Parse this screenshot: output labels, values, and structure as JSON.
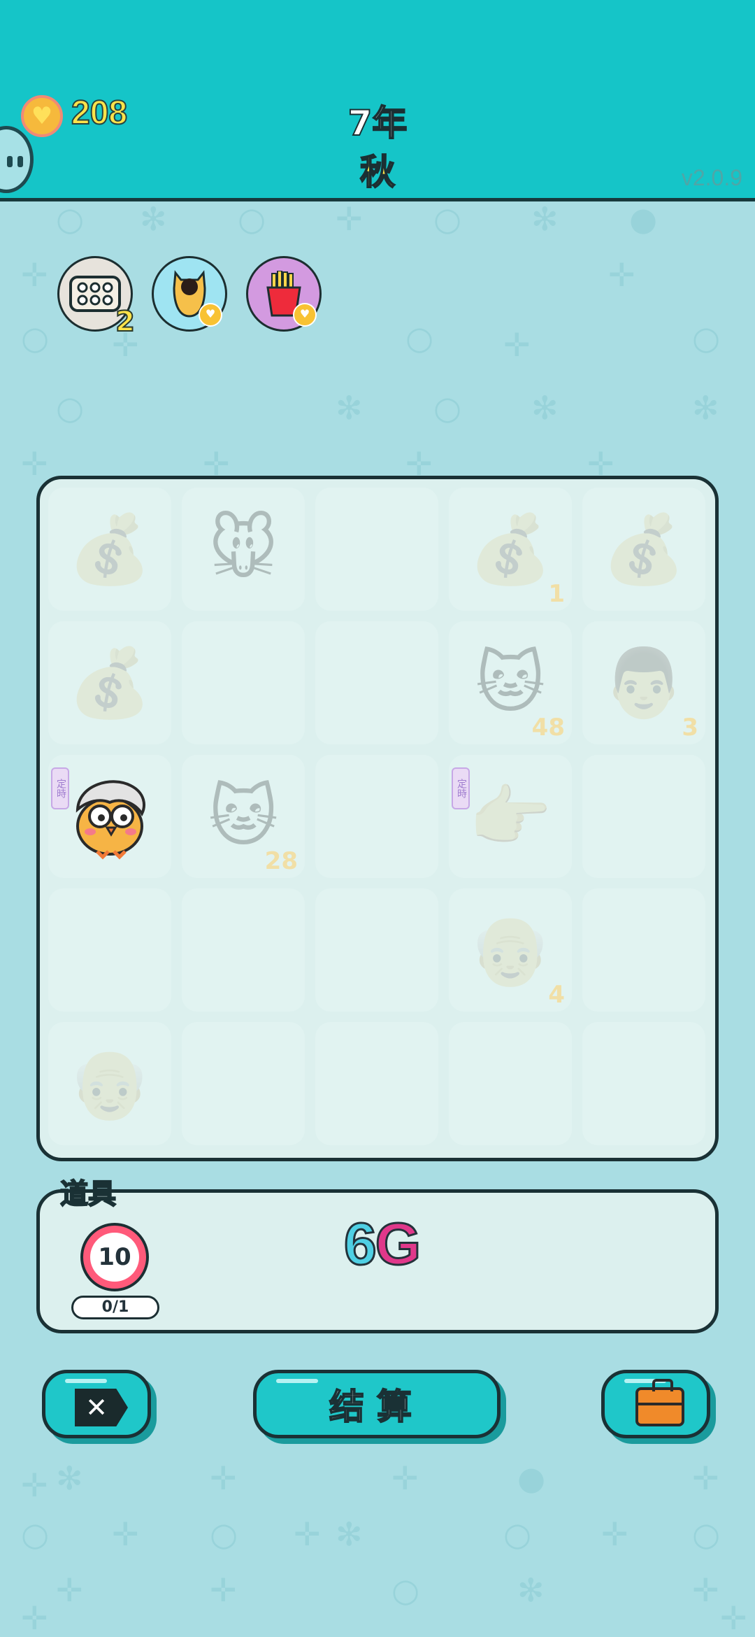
{
  "header": {
    "coins": "208",
    "year": "7年",
    "season": "秋",
    "version": "v2.0.9"
  },
  "effects": [
    {
      "icon": "egg-tray-icon",
      "quantity": "2"
    },
    {
      "icon": "cat-icon"
    },
    {
      "icon": "fries-icon"
    }
  ],
  "board": {
    "cells": [
      {
        "row": 0,
        "col": 0,
        "icon": "money-bag-icon"
      },
      {
        "row": 0,
        "col": 1,
        "icon": "mouse-icon"
      },
      {
        "row": 0,
        "col": 2,
        "icon": ""
      },
      {
        "row": 0,
        "col": 3,
        "icon": "money-bag-icon",
        "count": "1"
      },
      {
        "row": 0,
        "col": 4,
        "icon": "money-bag-icon"
      },
      {
        "row": 1,
        "col": 0,
        "icon": "money-bag-icon"
      },
      {
        "row": 1,
        "col": 1,
        "icon": ""
      },
      {
        "row": 1,
        "col": 2,
        "icon": ""
      },
      {
        "row": 1,
        "col": 3,
        "icon": "cat-icon",
        "count": "48"
      },
      {
        "row": 1,
        "col": 4,
        "icon": "man-face-icon",
        "count": "3"
      },
      {
        "row": 2,
        "col": 0,
        "icon": "bird-character",
        "tag": "定時"
      },
      {
        "row": 2,
        "col": 1,
        "icon": "cat-icon",
        "count": "28"
      },
      {
        "row": 2,
        "col": 2,
        "icon": ""
      },
      {
        "row": 2,
        "col": 3,
        "icon": "pointing-hand-icon",
        "tag": "定時"
      },
      {
        "row": 2,
        "col": 4,
        "icon": ""
      },
      {
        "row": 3,
        "col": 0,
        "icon": ""
      },
      {
        "row": 3,
        "col": 1,
        "icon": ""
      },
      {
        "row": 3,
        "col": 2,
        "icon": ""
      },
      {
        "row": 3,
        "col": 3,
        "icon": "old-man-face-icon",
        "count": "4"
      },
      {
        "row": 3,
        "col": 4,
        "icon": ""
      },
      {
        "row": 4,
        "col": 0,
        "icon": "old-man-face-icon"
      },
      {
        "row": 4,
        "col": 1,
        "icon": ""
      },
      {
        "row": 4,
        "col": 2,
        "icon": ""
      },
      {
        "row": 4,
        "col": 3,
        "icon": ""
      },
      {
        "row": 4,
        "col": 4,
        "icon": ""
      }
    ]
  },
  "items": {
    "label": "道具",
    "item_value": "10",
    "item_count": "0/1",
    "logo_six": "6",
    "logo_g": "G"
  },
  "buttons": {
    "close_icon": "close-x-icon",
    "settle_label": "结算",
    "bag_icon": "briefcase-icon"
  },
  "colors": {
    "header": "#15c5c8",
    "background": "#a9dde3",
    "board": "#dcf0ee",
    "button": "#1fc7c9",
    "accent_yellow": "#ffe34a",
    "accent_pink": "#e0388a"
  }
}
